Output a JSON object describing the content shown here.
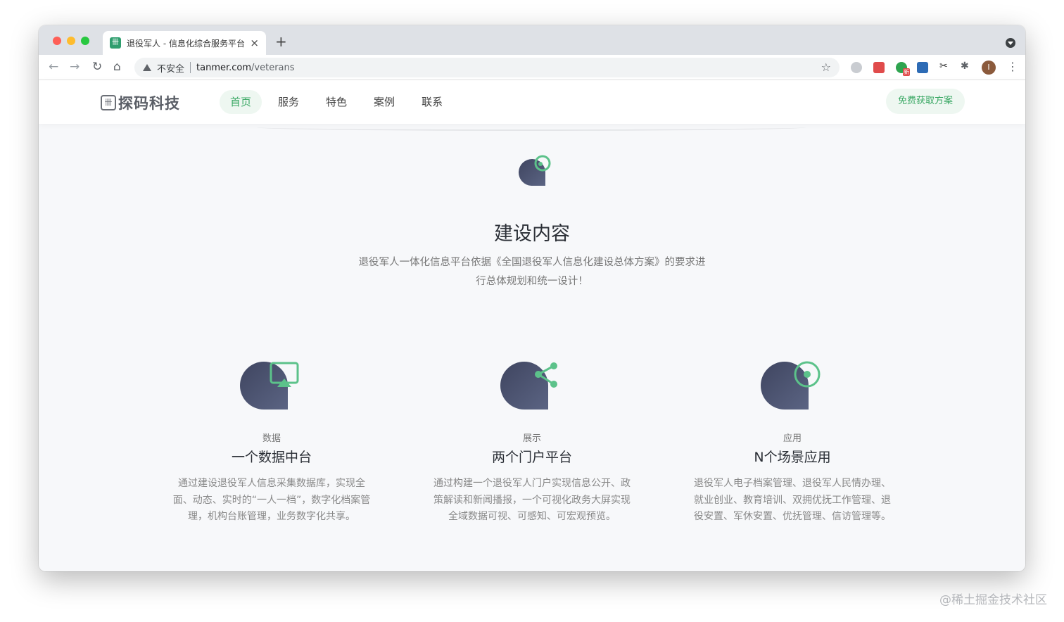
{
  "browser": {
    "tab_title": "退役军人 - 信息化综合服务平台",
    "tab_close": "×",
    "new_tab": "+",
    "security_label": "不安全",
    "url_host": "tanmer.com",
    "url_path": "/veterans",
    "avatar_letter": "I",
    "nav": {
      "back": "←",
      "forward": "→",
      "reload": "↻",
      "home": "⌂"
    },
    "star": "☆",
    "menu": "⋮",
    "ext_badge": "新"
  },
  "site": {
    "logo_mark": "卌",
    "logo_text": "探码科技",
    "nav_items": [
      "首页",
      "服务",
      "特色",
      "案例",
      "联系"
    ],
    "active_index": 0,
    "cta_label": "免费获取方案"
  },
  "section": {
    "title": "建设内容",
    "description": "退役军人一体化信息平台依据《全国退役军人信息化建设总体方案》的要求进行总体规划和统一设计！"
  },
  "features": [
    {
      "icon": "monitor-icon",
      "tag": "数据",
      "title": "一个数据中台",
      "description": "通过建设退役军人信息采集数据库，实现全面、动态、实时的“一人一档”，数字化档案管理，机构台账管理，业务数字化共享。"
    },
    {
      "icon": "share-icon",
      "tag": "展示",
      "title": "两个门户平台",
      "description": "通过构建一个退役军人门户实现信息公开、政策解读和新闻播报，一个可视化政务大屏实现全域数据可视、可感知、可宏观预览。"
    },
    {
      "icon": "target-icon",
      "tag": "应用",
      "title": "N个场景应用",
      "description": "退役军人电子档案管理、退役军人民情办理、就业创业、教育培训、双拥优抚工作管理、退役安置、军休安置、优抚管理、信访管理等。"
    }
  ],
  "watermark": "@稀土掘金技术社区",
  "colors": {
    "accent": "#3aa864",
    "icon_green": "#5cc28a",
    "icon_dark": "#4a5068",
    "page_bg": "#f7f8fa"
  }
}
